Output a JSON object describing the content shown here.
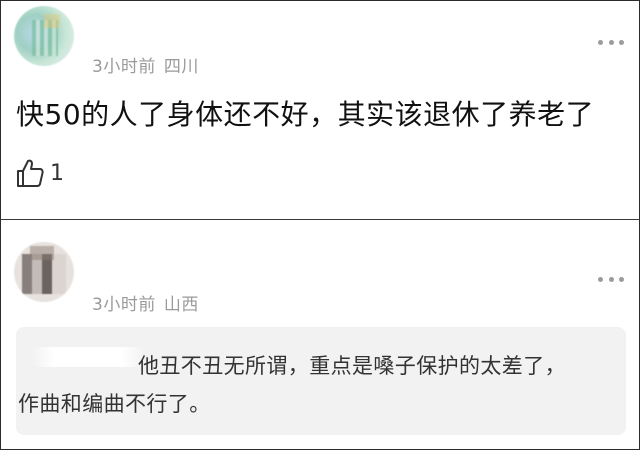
{
  "first_comment": {
    "time": "3小时前",
    "location": "四川",
    "text": "快50的人了身体还不好，其实该退休了养老了",
    "like_count": "1"
  },
  "second_comment": {
    "time": "3小时前",
    "location": "山西",
    "reply_line1": "他丑不丑无所谓，重点是嗓子保护的太差了，",
    "reply_line2": "作曲和编曲不行了。"
  },
  "icons": {
    "more": "more-icon",
    "like": "thumbs-up-icon"
  },
  "colors": {
    "meta_text": "#9a9a9a",
    "reply_background": "#f2f2f2"
  }
}
